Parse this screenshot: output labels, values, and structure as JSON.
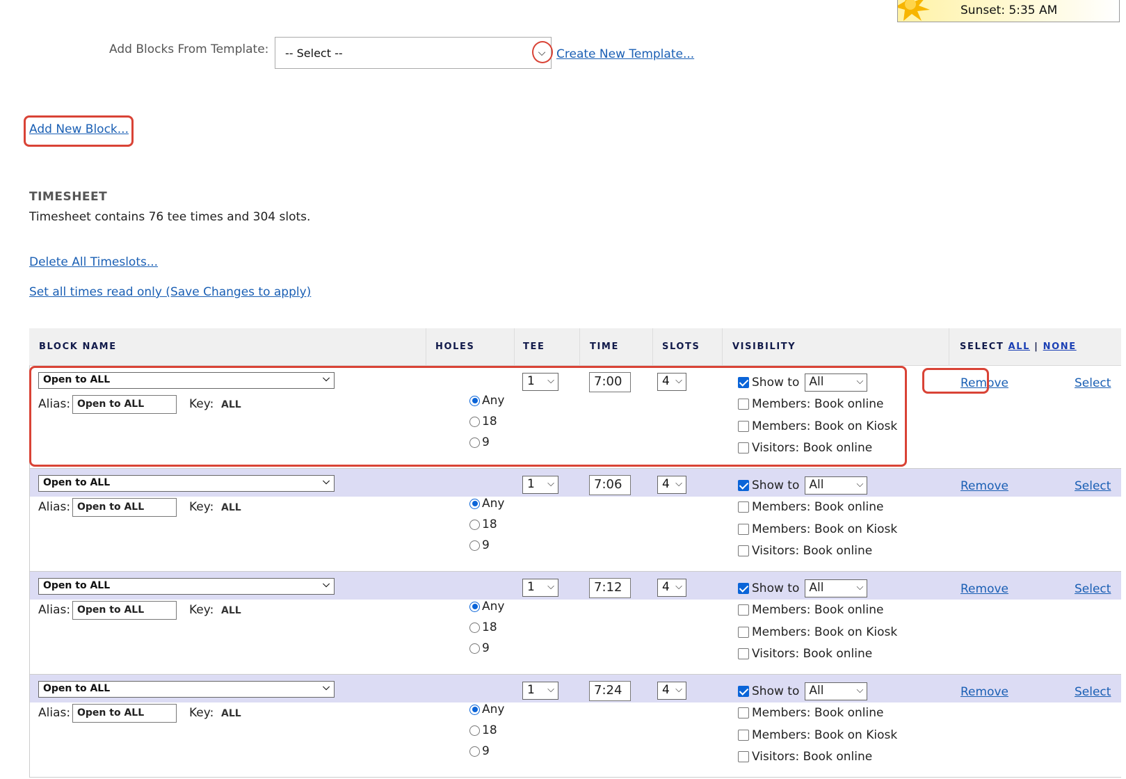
{
  "sun_widget": {
    "sunset_text": "Sunset: 5:35 AM"
  },
  "template": {
    "label": "Add Blocks From Template:",
    "select_value": "-- Select --",
    "create_link": "Create New Template..."
  },
  "add_block_link": "Add New Block...",
  "timesheet": {
    "title": "TIMESHEET",
    "description": "Timesheet contains 76 tee times and 304 slots.",
    "delete_link": "Delete All Timeslots...",
    "readonly_link": "Set all times read only (Save Changes to apply)"
  },
  "table": {
    "headers": {
      "block_name": "BLOCK NAME",
      "holes": "HOLES",
      "tee": "TEE",
      "time": "TIME",
      "slots": "SLOTS",
      "visibility": "VISIBILITY",
      "select_prefix": "SELECT",
      "select_all": "ALL",
      "select_sep": "|",
      "select_none": "NONE"
    },
    "labels": {
      "alias": "Alias:",
      "key": "Key:",
      "show_to": "Show to",
      "members_online": "Members: Book online",
      "members_kiosk": "Members: Book on Kiosk",
      "visitors_online": "Visitors: Book online",
      "remove": "Remove",
      "select": "Select"
    },
    "rows": [
      {
        "block": "Open to ALL",
        "alias": "Open to ALL",
        "key": "ALL",
        "holes_options": [
          "Any",
          "18",
          "9"
        ],
        "holes_selected": "Any",
        "tee": "1",
        "time": "7:00",
        "slots": "4",
        "show_to_checked": true,
        "show_to": "All"
      },
      {
        "block": "Open to ALL",
        "alias": "Open to ALL",
        "key": "ALL",
        "holes_options": [
          "Any",
          "18",
          "9"
        ],
        "holes_selected": "Any",
        "tee": "1",
        "time": "7:06",
        "slots": "4",
        "show_to_checked": true,
        "show_to": "All"
      },
      {
        "block": "Open to ALL",
        "alias": "Open to ALL",
        "key": "ALL",
        "holes_options": [
          "Any",
          "18",
          "9"
        ],
        "holes_selected": "Any",
        "tee": "1",
        "time": "7:12",
        "slots": "4",
        "show_to_checked": true,
        "show_to": "All"
      },
      {
        "block": "Open to ALL",
        "alias": "Open to ALL",
        "key": "ALL",
        "holes_options": [
          "Any",
          "18",
          "9"
        ],
        "holes_selected": "Any",
        "tee": "1",
        "time": "7:24",
        "slots": "4",
        "show_to_checked": true,
        "show_to": "All"
      }
    ]
  }
}
